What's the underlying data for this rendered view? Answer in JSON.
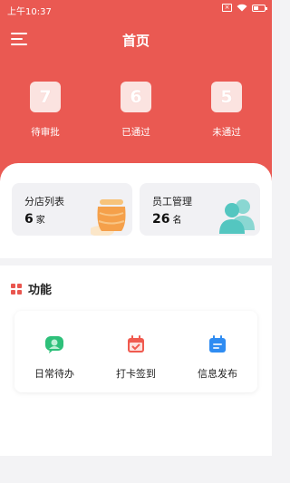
{
  "status_bar": {
    "time": "上午10:37"
  },
  "header": {
    "title": "首页"
  },
  "stats": [
    {
      "value": "7",
      "label": "待审批"
    },
    {
      "value": "6",
      "label": "已通过"
    },
    {
      "value": "5",
      "label": "未通过"
    }
  ],
  "summary_cards": [
    {
      "title": "分店列表",
      "value": "6",
      "unit": "家",
      "icon": "jar-icon"
    },
    {
      "title": "员工管理",
      "value": "26",
      "unit": "名",
      "icon": "people-icon"
    }
  ],
  "features": {
    "title": "功能",
    "items": [
      {
        "label": "日常待办",
        "icon": "chat-icon",
        "color": "#2ec07a"
      },
      {
        "label": "打卡签到",
        "icon": "calendar-check-icon",
        "color": "#f05a4f"
      },
      {
        "label": "信息发布",
        "icon": "notice-icon",
        "color": "#2f8cf2"
      }
    ]
  },
  "colors": {
    "primary": "#ea5952",
    "background": "#f3f3f5"
  }
}
